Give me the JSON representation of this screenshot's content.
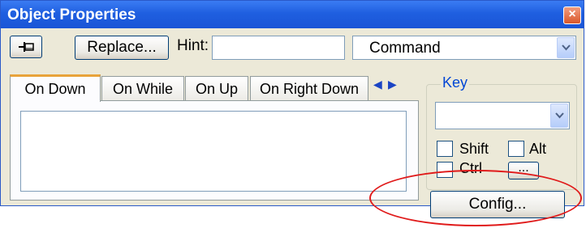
{
  "window": {
    "title": "Object Properties",
    "close_glyph": "×"
  },
  "toolbar": {
    "pin_icon": "pin-icon",
    "replace_label": "Replace...",
    "hint_label": "Hint:",
    "hint_value": "",
    "command_value": "Command"
  },
  "tabs": [
    {
      "label": "On Down",
      "active": true
    },
    {
      "label": "On While",
      "active": false
    },
    {
      "label": "On Up",
      "active": false
    },
    {
      "label": "On Right Down",
      "active": false
    }
  ],
  "tab_scroll": {
    "left": "◀",
    "right": "▶"
  },
  "key": {
    "legend": "Key",
    "value": "",
    "shift_label": "Shift",
    "alt_label": "Alt",
    "ctrl_label": "Ctrl",
    "dots_label": "...",
    "shift_checked": false,
    "alt_checked": false,
    "ctrl_checked": false
  },
  "config_label": "Config...",
  "colors": {
    "titlebar": "#1f5fe0",
    "annotation": "#e01a1a",
    "tab_accent": "#e8a33a"
  }
}
